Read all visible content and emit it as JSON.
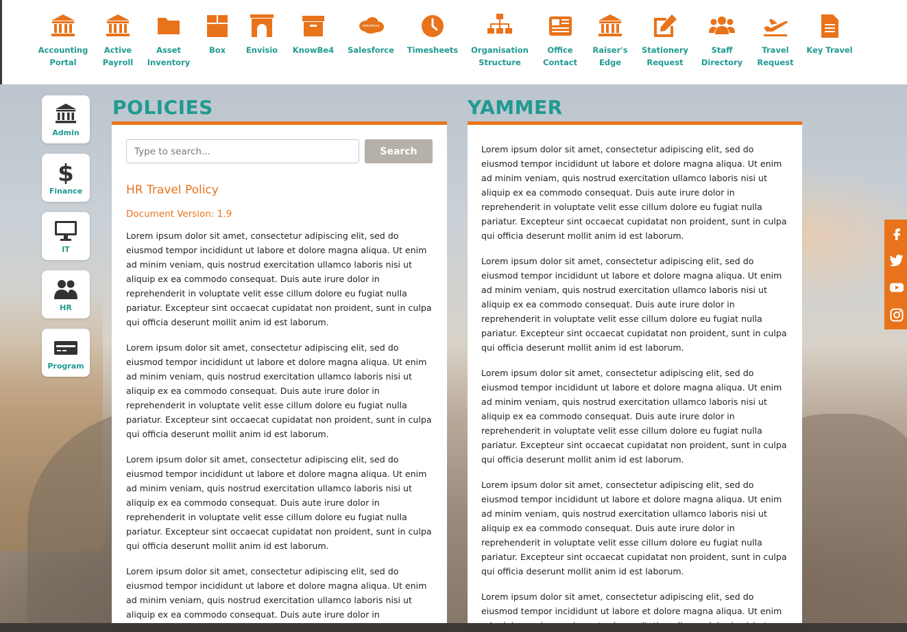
{
  "colors": {
    "accent": "#e8731a",
    "teal": "#1f9a92",
    "search_button": "#b5b0a8",
    "dark": "#3c3836"
  },
  "app_bar": {
    "items": [
      {
        "label": "Accounting\nPortal",
        "icon": "bank-icon"
      },
      {
        "label": "Active\nPayroll",
        "icon": "bank-icon"
      },
      {
        "label": "Asset\nInventory",
        "icon": "folder-icon"
      },
      {
        "label": "Box",
        "icon": "box-icon"
      },
      {
        "label": "Envisio",
        "icon": "arch-icon"
      },
      {
        "label": "KnowBe4",
        "icon": "archive-icon"
      },
      {
        "label": "Salesforce",
        "icon": "salesforce-cloud-icon"
      },
      {
        "label": "Timesheets",
        "icon": "clock-icon"
      },
      {
        "label": "Organisation\nStructure",
        "icon": "org-chart-icon"
      },
      {
        "label": "Office\nContact",
        "icon": "newspaper-icon"
      },
      {
        "label": "Raiser's\nEdge",
        "icon": "bank-icon"
      },
      {
        "label": "Stationery\nRequest",
        "icon": "edit-icon"
      },
      {
        "label": "Staff\nDirectory",
        "icon": "users-icon"
      },
      {
        "label": "Travel\nRequest",
        "icon": "plane-icon"
      },
      {
        "label": "Key Travel",
        "icon": "document-icon"
      }
    ]
  },
  "categories": [
    {
      "label": "Admin",
      "icon": "bank-icon"
    },
    {
      "label": "Finance",
      "icon": "dollar-icon"
    },
    {
      "label": "IT",
      "icon": "monitor-icon"
    },
    {
      "label": "HR",
      "icon": "users-icon"
    },
    {
      "label": "Program",
      "icon": "card-icon"
    }
  ],
  "policies": {
    "heading": "POLICIES",
    "search_placeholder": "Type to search...",
    "search_button": "Search",
    "doc_title": "HR Travel Policy",
    "doc_version": "Document Version: 1.9",
    "paragraphs": [
      "Lorem ipsum dolor sit amet, consectetur adipiscing elit, sed do eiusmod tempor incididunt ut labore et dolore magna aliqua. Ut enim ad minim veniam, quis nostrud exercitation ullamco laboris nisi ut aliquip ex ea commodo consequat. Duis aute irure dolor in reprehenderit in voluptate velit esse cillum dolore eu fugiat nulla pariatur. Excepteur sint occaecat cupidatat non proident, sunt in culpa qui officia deserunt mollit anim id est laborum.",
      "Lorem ipsum dolor sit amet, consectetur adipiscing elit, sed do eiusmod tempor incididunt ut labore et dolore magna aliqua. Ut enim ad minim veniam, quis nostrud exercitation ullamco laboris nisi ut aliquip ex ea commodo consequat. Duis aute irure dolor in reprehenderit in voluptate velit esse cillum dolore eu fugiat nulla pariatur. Excepteur sint occaecat cupidatat non proident, sunt in culpa qui officia deserunt mollit anim id est laborum.",
      "Lorem ipsum dolor sit amet, consectetur adipiscing elit, sed do eiusmod tempor incididunt ut labore et dolore magna aliqua. Ut enim ad minim veniam, quis nostrud exercitation ullamco laboris nisi ut aliquip ex ea commodo consequat. Duis aute irure dolor in reprehenderit in voluptate velit esse cillum dolore eu fugiat nulla pariatur. Excepteur sint occaecat cupidatat non proident, sunt in culpa qui officia deserunt mollit anim id est laborum.",
      "Lorem ipsum dolor sit amet, consectetur adipiscing elit, sed do eiusmod tempor incididunt ut labore et dolore magna aliqua. Ut enim ad minim veniam, quis nostrud exercitation ullamco laboris nisi ut aliquip ex ea commodo consequat. Duis aute irure dolor in reprehenderit in voluptate velit esse cillum dolore eu fugiat nulla pariatur."
    ]
  },
  "yammer": {
    "heading": "YAMMER",
    "paragraphs": [
      "Lorem ipsum dolor sit amet, consectetur adipiscing elit, sed do eiusmod tempor incididunt ut labore et dolore magna aliqua. Ut enim ad minim veniam, quis nostrud exercitation ullamco laboris nisi ut aliquip ex ea commodo consequat. Duis aute irure dolor in reprehenderit in voluptate velit esse cillum dolore eu fugiat nulla pariatur. Excepteur sint occaecat cupidatat non proident, sunt in culpa qui officia deserunt mollit anim id est laborum.",
      "Lorem ipsum dolor sit amet, consectetur adipiscing elit, sed do eiusmod tempor incididunt ut labore et dolore magna aliqua. Ut enim ad minim veniam, quis nostrud exercitation ullamco laboris nisi ut aliquip ex ea commodo consequat. Duis aute irure dolor in reprehenderit in voluptate velit esse cillum dolore eu fugiat nulla pariatur. Excepteur sint occaecat cupidatat non proident, sunt in culpa qui officia deserunt mollit anim id est laborum.",
      "Lorem ipsum dolor sit amet, consectetur adipiscing elit, sed do eiusmod tempor incididunt ut labore et dolore magna aliqua. Ut enim ad minim veniam, quis nostrud exercitation ullamco laboris nisi ut aliquip ex ea commodo consequat. Duis aute irure dolor in reprehenderit in voluptate velit esse cillum dolore eu fugiat nulla pariatur. Excepteur sint occaecat cupidatat non proident, sunt in culpa qui officia deserunt mollit anim id est laborum.",
      "Lorem ipsum dolor sit amet, consectetur adipiscing elit, sed do eiusmod tempor incididunt ut labore et dolore magna aliqua. Ut enim ad minim veniam, quis nostrud exercitation ullamco laboris nisi ut aliquip ex ea commodo consequat. Duis aute irure dolor in reprehenderit in voluptate velit esse cillum dolore eu fugiat nulla pariatur. Excepteur sint occaecat cupidatat non proident, sunt in culpa qui officia deserunt mollit anim id est laborum.",
      "Lorem ipsum dolor sit amet, consectetur adipiscing elit, sed do eiusmod tempor incididunt ut labore et dolore magna aliqua. Ut enim ad minim veniam, quis nostrud exercitation ullamco laboris nisi ut"
    ]
  },
  "social": [
    {
      "icon": "facebook-icon"
    },
    {
      "icon": "twitter-icon"
    },
    {
      "icon": "youtube-icon"
    },
    {
      "icon": "instagram-icon"
    }
  ]
}
